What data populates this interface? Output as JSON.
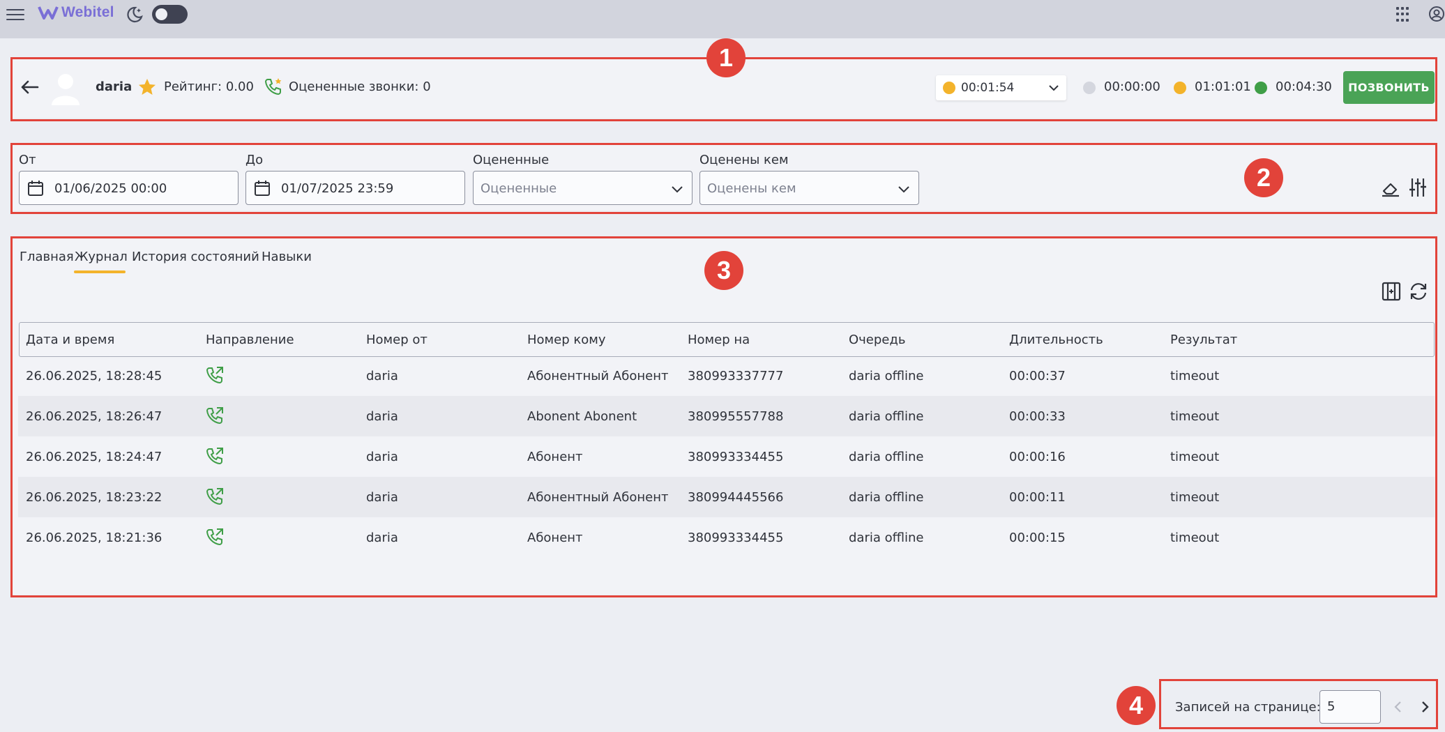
{
  "topbar": {
    "logo_text": "Webitel",
    "icons": [
      "menu-icon",
      "logo-icon",
      "moon-icon",
      "theme-toggle",
      "apps-grid-icon",
      "user-icon"
    ]
  },
  "annotations": [
    "1",
    "2",
    "3",
    "4"
  ],
  "header": {
    "agent_name": "daria",
    "rating": "Рейтинг: 0.00",
    "rated_calls": "Оцененные звонки: 0",
    "status_timer": "00:01:54",
    "timers": [
      {
        "value": "00:00:00",
        "color": "#d4d6de"
      },
      {
        "value": "01:01:01",
        "color": "#f3b32b"
      },
      {
        "value": "00:04:30",
        "color": "#3f9e47"
      }
    ],
    "status_color": "#f3b32b",
    "call_button": "ПОЗВОНИТЬ",
    "call_button_color": "#4aa356"
  },
  "filters": {
    "from_label": "От",
    "from_value": "01/06/2025 00:00",
    "to_label": "До",
    "to_value": "01/07/2025 23:59",
    "rated_label": "Оцененные",
    "rated_placeholder": "Оцененные",
    "rated_by_label": "Оценены кем",
    "rated_by_placeholder": "Оценены кем"
  },
  "tabs": [
    {
      "label": "Главная",
      "active": false
    },
    {
      "label": "Журнал",
      "active": true
    },
    {
      "label": "История состояний",
      "active": false
    },
    {
      "label": "Навыки",
      "active": false
    }
  ],
  "table": {
    "headers": [
      "Дата и время",
      "Направление",
      "Номер от",
      "Номер кому",
      "Номер на",
      "Очередь",
      "Длительность",
      "Результат"
    ],
    "rows": [
      {
        "date": "26.06.2025, 18:28:45",
        "direction": "outbound-call-icon",
        "from": "daria",
        "to": "Абонентный Абонент",
        "number": "380993337777",
        "queue": "daria offline",
        "duration": "00:00:37",
        "result": "timeout"
      },
      {
        "date": "26.06.2025, 18:26:47",
        "direction": "outbound-call-icon",
        "from": "daria",
        "to": "Abonent Abonent",
        "number": "380995557788",
        "queue": "daria offline",
        "duration": "00:00:33",
        "result": "timeout"
      },
      {
        "date": "26.06.2025, 18:24:47",
        "direction": "outbound-call-icon",
        "from": "daria",
        "to": "Абонент",
        "number": "380993334455",
        "queue": "daria offline",
        "duration": "00:00:16",
        "result": "timeout"
      },
      {
        "date": "26.06.2025, 18:23:22",
        "direction": "outbound-call-icon",
        "from": "daria",
        "to": "Абонентный Абонент",
        "number": "380994445566",
        "queue": "daria offline",
        "duration": "00:00:11",
        "result": "timeout"
      },
      {
        "date": "26.06.2025, 18:21:36",
        "direction": "outbound-call-icon",
        "from": "daria",
        "to": "Абонент",
        "number": "380993334455",
        "queue": "daria offline",
        "duration": "00:00:15",
        "result": "timeout"
      }
    ]
  },
  "pagination": {
    "label": "Записей на странице:",
    "per_page": "5"
  },
  "colors": {
    "accent": "#f3b32b",
    "annotation": "#e2433a",
    "call_green": "#3f9e47"
  }
}
